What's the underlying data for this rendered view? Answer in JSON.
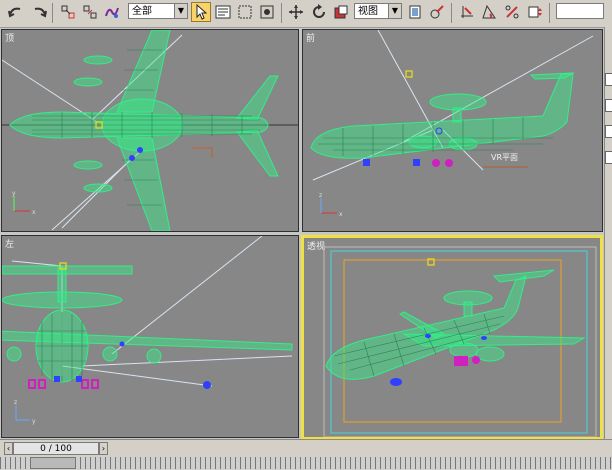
{
  "toolbar": {
    "selection_filter": "全部",
    "reference_coord": "视图"
  },
  "viewports": {
    "top": {
      "label": "顶"
    },
    "front": {
      "label": "前",
      "object_label": "VR平面"
    },
    "left": {
      "label": "左"
    },
    "perspective": {
      "label": "透视"
    }
  },
  "timeline": {
    "frame_counter": "0 / 100"
  },
  "colors": {
    "wireframe": "#33ee88",
    "viewport_bg": "#878787",
    "active_border": "#f0e040"
  }
}
